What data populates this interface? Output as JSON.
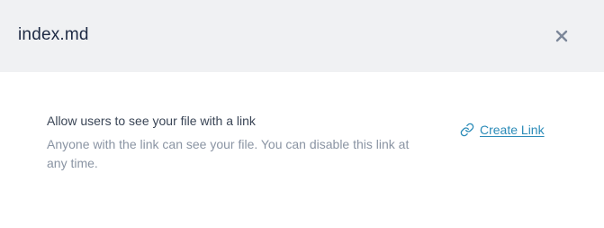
{
  "dialog": {
    "title": "index.md",
    "close_icon": "close-icon"
  },
  "share": {
    "heading": "Allow users to see your file with a link",
    "description": "Anyone with the link can see your file. You can disable this link at any time.",
    "create_link_label": "Create Link",
    "create_link_icon": "link-icon"
  },
  "colors": {
    "header_bg": "#f0f1f3",
    "title": "#1e2a44",
    "link": "#2b8bb8",
    "muted": "#8a94a3"
  }
}
